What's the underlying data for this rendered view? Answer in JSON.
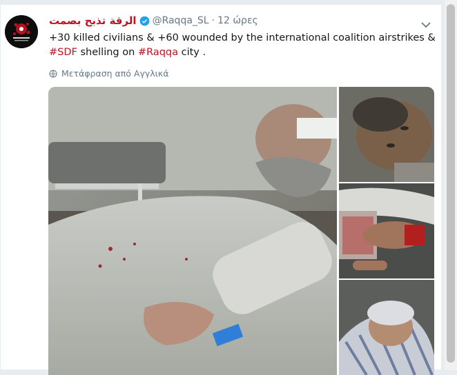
{
  "tweet": {
    "display_name": "الرقة تذبح بصمت",
    "handle": "@Raqqa_SL",
    "separator": "·",
    "time": "12 ώρες",
    "text_part1": "+30 killed civilians & +60 wounded by the international coalition airstrikes &",
    "hashtag1": "#SDF",
    "text_part2": " shelling on ",
    "hashtag2": "#Raqqa",
    "text_part3": " city .",
    "translate_label": "Μετάφραση από Αγγλικά"
  },
  "icons": {
    "verified": "verified-badge-icon",
    "globe": "globe-icon",
    "chevron": "chevron-down-icon"
  },
  "colors": {
    "accent": "#c1121f",
    "verified": "#1da1f2",
    "muted": "#657786",
    "text": "#14171a"
  }
}
